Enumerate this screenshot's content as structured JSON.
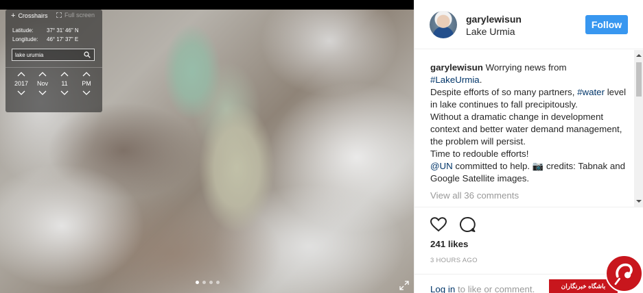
{
  "map": {
    "crosshairs_label": "Crosshairs",
    "fullscreen_label": "Full screen",
    "latitude_label": "Latitude:",
    "latitude_value": "37° 31' 46\" N",
    "longitude_label": "Longitude:",
    "longitude_value": "46° 17' 37\" E",
    "search_value": "lake urumia",
    "time": {
      "year": "2017",
      "month": "Nov",
      "day": "11",
      "period": "PM"
    },
    "carousel": {
      "count": 4,
      "active_index": 0
    }
  },
  "post": {
    "username": "garylewisun",
    "location": "Lake Urmia",
    "follow_label": "Follow",
    "caption": {
      "username": "garylewisun",
      "intro": "Worrying news from",
      "hashtag_lake": "#LakeUrmia",
      "line_despite": "Despite efforts of so many partners,",
      "hashtag_water": "#water",
      "line_level": "level in lake continues to fall precipitously.",
      "line_without": "Without a dramatic change in development context and better water demand management, the problem will persist.",
      "line_time": "Time to redouble efforts!",
      "mention_un": "@UN",
      "line_committed": "committed to help. 📷 credits: Tabnak and Google Satellite images."
    },
    "view_all_comments": "View all 36 comments",
    "likes": "241 likes",
    "timestamp": "3 HOURS AGO",
    "login_link": "Log in",
    "login_rest": "to like or comment."
  },
  "watermark": {
    "text": "باشگاه خبرنگاران"
  },
  "colors": {
    "follow_button": "#3897f0",
    "link": "#003569",
    "muted": "#999999",
    "watermark_red": "#c8161d"
  }
}
